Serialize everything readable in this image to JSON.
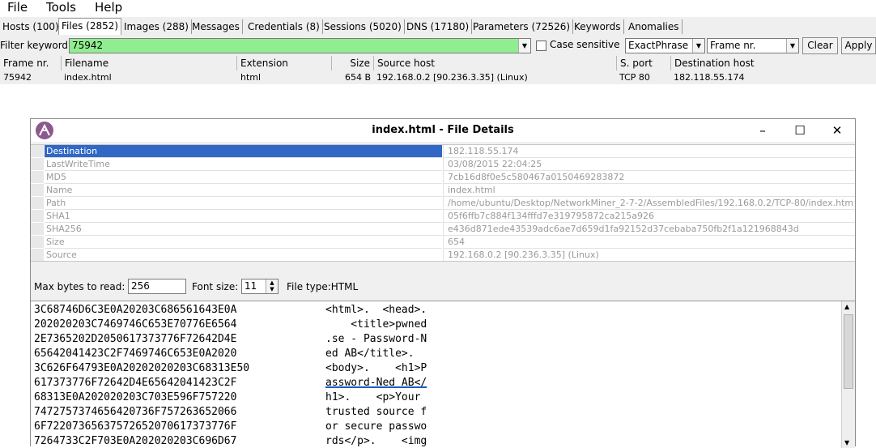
{
  "menu": [
    "File",
    "Tools",
    "Help"
  ],
  "tabs": [
    "Hosts (100)",
    "Files (2852)",
    "Images (288)",
    "Messages",
    "Credentials (8)",
    "Sessions (5020)",
    "DNS (17180)",
    "Parameters (72526)",
    "Keywords",
    "Anomalies"
  ],
  "active_tab": "Files (2852)",
  "filter": {
    "label": "Filter keyword:",
    "value": "75942",
    "case_label": "Case sensitive",
    "mode": "ExactPhrase",
    "column": "Frame nr.",
    "clear": "Clear",
    "apply": "Apply"
  },
  "grid": {
    "headers": [
      "Frame nr.",
      "Filename",
      "Extension",
      "Size",
      "Source host",
      "S. port",
      "Destination host"
    ],
    "row": {
      "frame": "75942",
      "filename": "index.html",
      "extension": "html",
      "size": "654 B",
      "source": "192.168.0.2 [90.236.3.35] (Linux)",
      "sport": "TCP 80",
      "dest": "182.118.55.174"
    }
  },
  "dialog": {
    "title": "index.html - File Details",
    "props": [
      {
        "key": "Destination",
        "value": "182.118.55.174"
      },
      {
        "key": "LastWriteTime",
        "value": "03/08/2015 22:04:25"
      },
      {
        "key": "MD5",
        "value": "7cb16d8f0e5c580467a0150469283872"
      },
      {
        "key": "Name",
        "value": "index.html"
      },
      {
        "key": "Path",
        "value": "/home/ubuntu/Desktop/NetworkMiner_2-7-2/AssembledFiles/192.168.0.2/TCP-80/index.htm"
      },
      {
        "key": "SHA1",
        "value": "05f6ffb7c884f134fffd7e319795872ca215a926"
      },
      {
        "key": "SHA256",
        "value": "e436d871ede43539adc6ae7d659d1fa92152d37cebaba750fb2f1a121968843d"
      },
      {
        "key": "Size",
        "value": "654"
      },
      {
        "key": "Source",
        "value": "192.168.0.2 [90.236.3.35] (Linux)"
      }
    ],
    "max_bytes_label": "Max bytes to read:",
    "max_bytes": "256",
    "font_size_label": "Font size:",
    "font_size": "11",
    "file_type": "File type:HTML",
    "hex_lines": [
      "3C68746D6C3E0A20203C686561643E0A",
      "202020203C7469746C653E70776E6564",
      "2E7365202D2050617373776F72642D4E",
      "65642041423C2F7469746C653E0A2020",
      "3C626F64793E0A20202020203C68313E50",
      "617373776F72642D4E65642041423C2F",
      "68313E0A202020203C703E596F757220",
      "7472757374656420736F757263652066",
      "6F72207365637572652070617373776F",
      "7264733C2F703E0A202020203C696D67"
    ],
    "ascii_lines": [
      "<html>.  <head>.",
      "    <title>pwned",
      ".se - Password-N",
      "ed AB</title>.",
      "<body>.    <h1>P",
      "assword-Ned AB</",
      "h1>.    <p>Your",
      "trusted source f",
      "or secure passwo",
      "rds</p>.    <img"
    ]
  }
}
